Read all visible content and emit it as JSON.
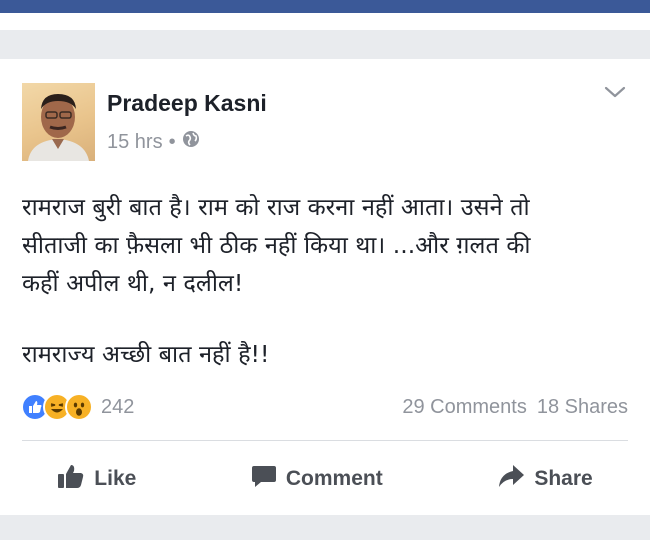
{
  "post": {
    "author": "Pradeep Kasni",
    "time": "15 hrs",
    "separator": "•",
    "privacy_icon": "globe-icon",
    "text_lines": [
      "रामराज बुरी बात है। राम को राज करना नहीं आता। उसने तो",
      "सीताजी का फ़ैसला भी ठीक नहीं किया था। ...और ग़लत की",
      "कहीं अपील थी, न दलील!",
      "",
      "रामराज्य अच्छी बात नहीं है!!"
    ],
    "reactions": {
      "icons": [
        "like-reaction-icon",
        "haha-reaction-icon",
        "wow-reaction-icon"
      ],
      "count": "242"
    },
    "comments_count": "29 Comments",
    "shares_count": "18 Shares",
    "actions": {
      "like": "Like",
      "comment": "Comment",
      "share": "Share"
    }
  },
  "colors": {
    "brand": "#3b5998",
    "text": "#1d2129",
    "meta": "#90949c",
    "action": "#4b4f56",
    "like_blue": "#4080ff",
    "emoji_yellow": "#f7b125"
  }
}
